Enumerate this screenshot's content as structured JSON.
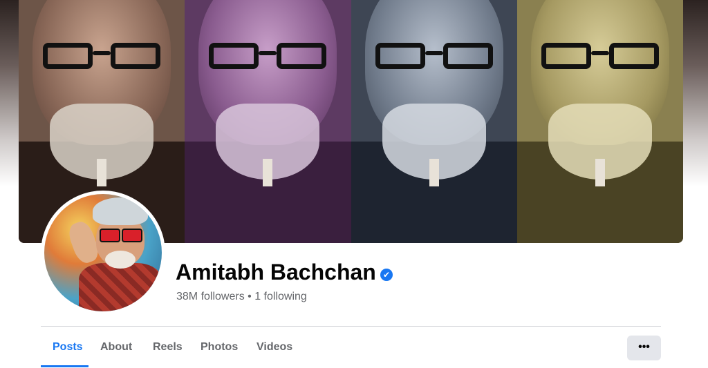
{
  "profile": {
    "name": "Amitabh Bachchan",
    "verified_mark": "✔",
    "followers_line": "38M followers • 1 following"
  },
  "tabs": [
    {
      "label": "Posts",
      "active": true
    },
    {
      "label": "About",
      "active": false
    },
    {
      "label": "Reels",
      "active": false
    },
    {
      "label": "Photos",
      "active": false
    },
    {
      "label": "Videos",
      "active": false
    }
  ],
  "more_button": {
    "label": "•••",
    "icon": "more-icon"
  },
  "colors": {
    "accent": "#1877f2",
    "secondary_text": "#65676b",
    "button_bg": "#e4e6eb"
  }
}
